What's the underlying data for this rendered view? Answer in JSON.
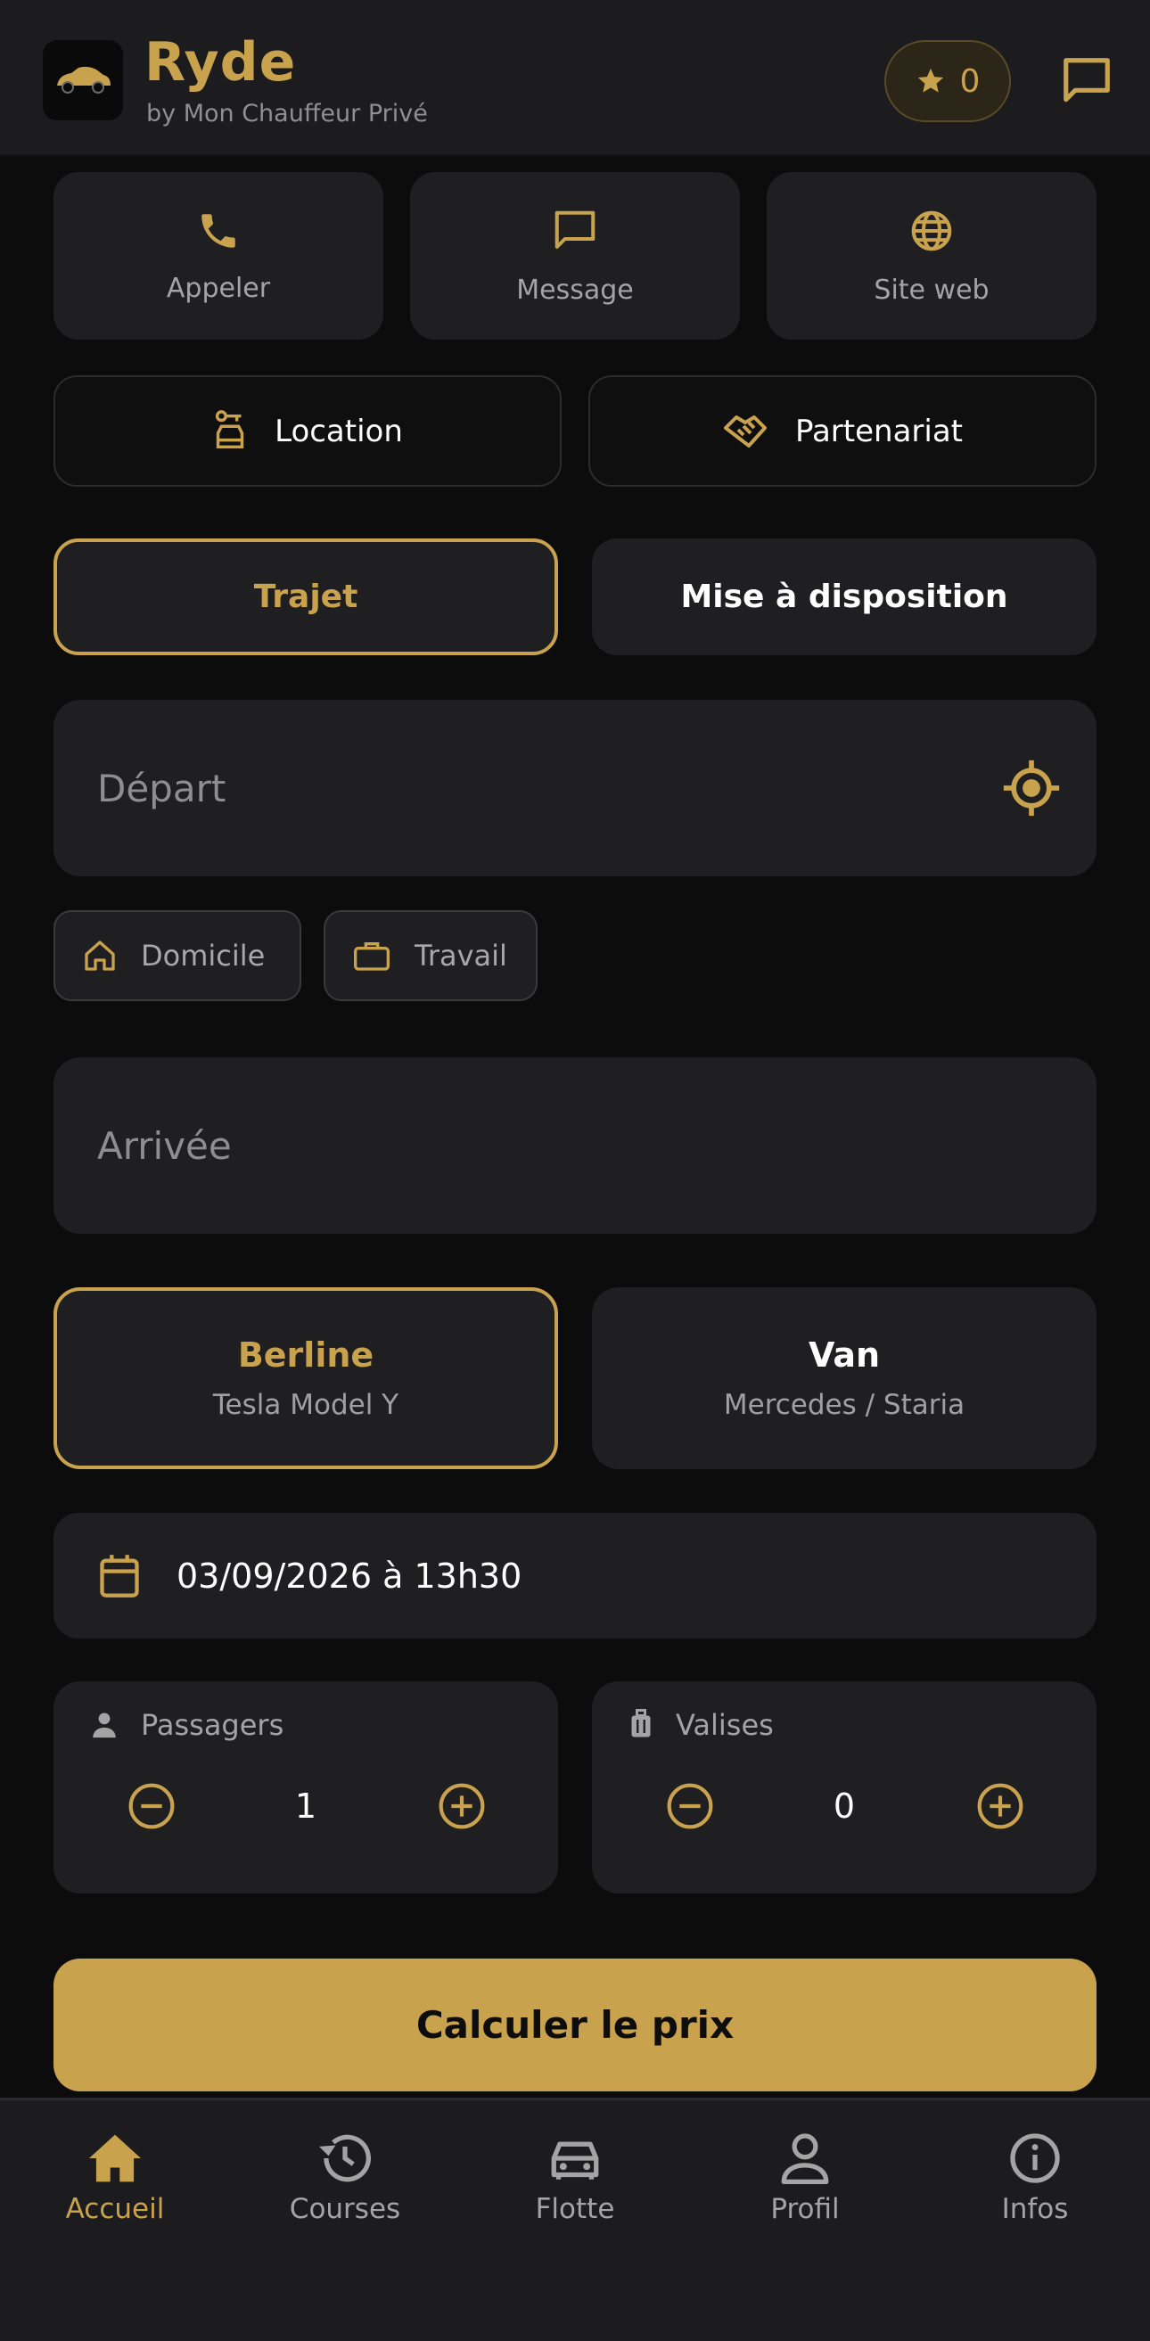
{
  "header": {
    "title": "Ryde",
    "subtitle": "by Mon Chauffeur Privé",
    "points": "0"
  },
  "quick_actions": [
    {
      "label": "Appeler",
      "icon": "phone-icon"
    },
    {
      "label": "Message",
      "icon": "message-icon"
    },
    {
      "label": "Site web",
      "icon": "globe-icon"
    }
  ],
  "services": [
    {
      "label": "Location",
      "icon": "car-rental-icon"
    },
    {
      "label": "Partenariat",
      "icon": "handshake-icon"
    }
  ],
  "mode_tabs": [
    {
      "label": "Trajet",
      "active": true
    },
    {
      "label": "Mise à disposition",
      "active": false
    }
  ],
  "departure": {
    "placeholder": "Départ"
  },
  "shortcuts": [
    {
      "label": "Domicile",
      "icon": "home-icon"
    },
    {
      "label": "Travail",
      "icon": "briefcase-icon"
    }
  ],
  "arrival": {
    "placeholder": "Arrivée"
  },
  "vehicles": [
    {
      "name": "Berline",
      "model": "Tesla Model Y",
      "active": true
    },
    {
      "name": "Van",
      "model": "Mercedes / Staria",
      "active": false
    }
  ],
  "datetime": "03/09/2026 à 13h30",
  "passengers": {
    "label": "Passagers",
    "value": "1"
  },
  "luggage": {
    "label": "Valises",
    "value": "0"
  },
  "cta": "Calculer le prix",
  "tabs": [
    {
      "label": "Accueil",
      "icon": "home-icon",
      "active": true
    },
    {
      "label": "Courses",
      "icon": "history-icon",
      "active": false
    },
    {
      "label": "Flotte",
      "icon": "car-icon",
      "active": false
    },
    {
      "label": "Profil",
      "icon": "person-icon",
      "active": false
    },
    {
      "label": "Infos",
      "icon": "info-icon",
      "active": false
    }
  ],
  "colors": {
    "accent": "#c9a24d",
    "background": "#0c0c0c",
    "surface": "#1f1f21"
  }
}
